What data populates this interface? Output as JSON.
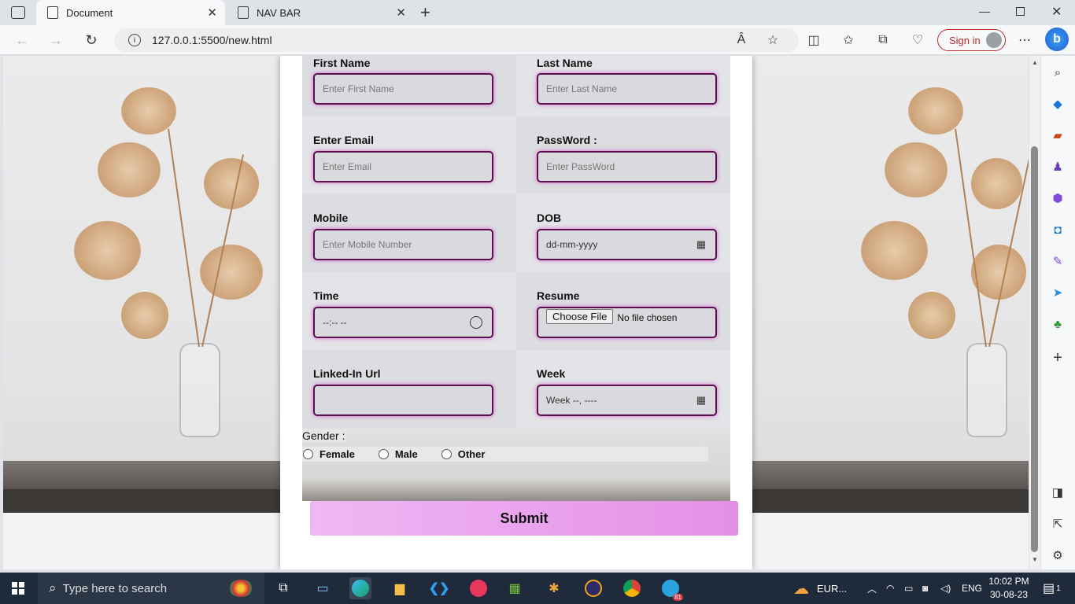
{
  "browser": {
    "tabs": [
      {
        "label": "Document",
        "active": true
      },
      {
        "label": "NAV BAR",
        "active": false
      }
    ],
    "url": "127.0.0.1:5500/new.html",
    "sign_in": "Sign in",
    "read_aloud": "Ȃ"
  },
  "form": {
    "first_name": {
      "label": "First Name",
      "placeholder": "Enter First Name"
    },
    "last_name": {
      "label": "Last Name",
      "placeholder": "Enter Last Name"
    },
    "email": {
      "label": "Enter Email",
      "placeholder": "Enter Email"
    },
    "password": {
      "label": "PassWord :",
      "placeholder": "Enter PassWord"
    },
    "mobile": {
      "label": "Mobile",
      "placeholder": "Enter Mobile Number"
    },
    "dob": {
      "label": "DOB",
      "value": "dd-mm-yyyy"
    },
    "time": {
      "label": "Time",
      "value": "--:-- --"
    },
    "resume": {
      "label": "Resume",
      "button": "Choose File",
      "status": "No file chosen"
    },
    "linkedin": {
      "label": "Linked-In Url",
      "value": ""
    },
    "week": {
      "label": "Week",
      "value": "Week --, ----"
    },
    "gender": {
      "label": "Gender :",
      "options": [
        "Female",
        "Male",
        "Other"
      ]
    },
    "submit": "Submit"
  },
  "taskbar": {
    "search_placeholder": "Type here to search",
    "weather": "EUR...",
    "language": "ENG",
    "time": "10:02 PM",
    "date": "30-08-23",
    "notifications": "1",
    "telegram_badge": "81"
  },
  "colors": {
    "input_border": "#5a0f4f",
    "input_glow": "#d86ad0",
    "submit_start": "#efb8f4",
    "submit_end": "#e48fe6",
    "signin": "#b82d2d"
  }
}
